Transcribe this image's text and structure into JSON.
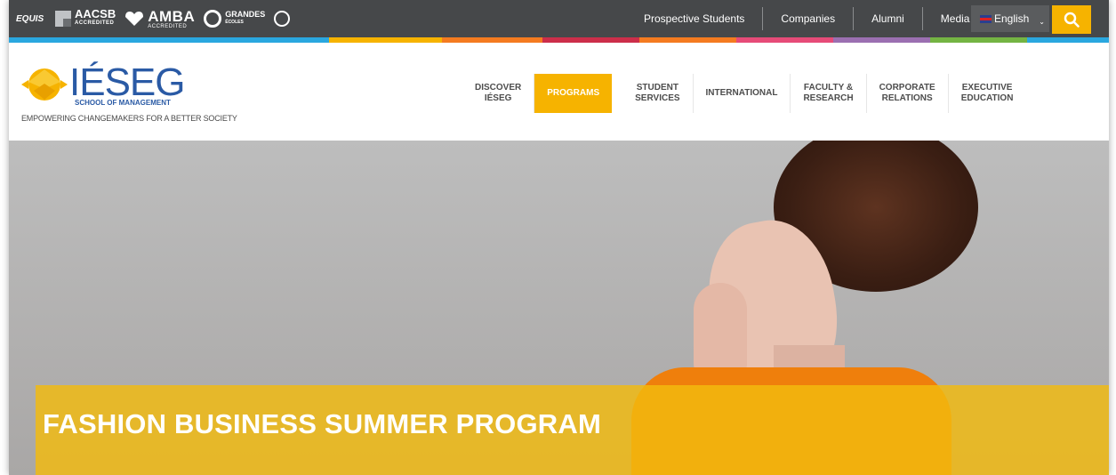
{
  "accreditations": {
    "equis": "EQUIS",
    "aacsb": "AACSB",
    "aacsb_sub": "ACCREDITED",
    "amba": "AMBA",
    "amba_sub": "ACCREDITED",
    "cge_line1": "GRANDES",
    "cge_line2": "ÉCOLES"
  },
  "topbar": {
    "links": [
      "Prospective Students",
      "Companies",
      "Alumni",
      "Media"
    ],
    "language": "English"
  },
  "colorbar": [
    "#2aa7df",
    "#f6b300",
    "#f47b20",
    "#cc2e4a",
    "#f47b20",
    "#e64b78",
    "#9b6fb1",
    "#74b443",
    "#2aa7df"
  ],
  "brand": {
    "name": "IÉSEG",
    "school": "SCHOOL OF MANAGEMENT",
    "tagline": "EMPOWERING CHANGEMAKERS FOR A BETTER SOCIETY"
  },
  "nav": {
    "items": [
      {
        "line1": "DISCOVER",
        "line2": "IÉSEG"
      },
      {
        "line1": "PROGRAMS",
        "line2": ""
      },
      {
        "line1": "STUDENT",
        "line2": "SERVICES"
      },
      {
        "line1": "INTERNATIONAL",
        "line2": ""
      },
      {
        "line1": "FACULTY &",
        "line2": "RESEARCH"
      },
      {
        "line1": "CORPORATE",
        "line2": "RELATIONS"
      },
      {
        "line1": "EXECUTIVE",
        "line2": "EDUCATION"
      }
    ],
    "active_index": 1
  },
  "hero": {
    "title": "FASHION BUSINESS SUMMER PROGRAM"
  }
}
